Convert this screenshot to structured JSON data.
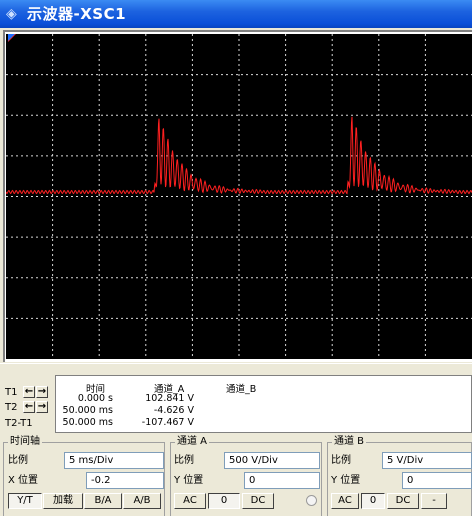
{
  "window": {
    "title": "示波器-XSC1",
    "icon": "oscilloscope-icon"
  },
  "screen": {
    "background": "#000000",
    "grid_color": "#d8d8d8",
    "trace_color": "#ff2020",
    "divisions": {
      "x": 10,
      "y": 8
    },
    "trace_description": "Repeating damped ringing pulses on a flat baseline"
  },
  "cursors": {
    "t1_label": "T1",
    "t2_label": "T2",
    "diff_label": "T2-T1",
    "t1_color": "#ff2020",
    "t2_color": "#1e6fff"
  },
  "readout": {
    "col_time": "时间",
    "col_a": "通道_A",
    "col_b": "通道_B",
    "rows": [
      {
        "time": "0.000 s",
        "a": "102.841 V",
        "b": ""
      },
      {
        "time": "50.000 ms",
        "a": "-4.626 V",
        "b": ""
      },
      {
        "time": "50.000 ms",
        "a": "-107.467 V",
        "b": ""
      }
    ]
  },
  "timebase": {
    "title": "时间轴",
    "scale_label": "比例",
    "scale_value": "5 ms/Div",
    "xpos_label": "X 位置",
    "xpos_value": "-0.2",
    "buttons": [
      "Y/T",
      "加载",
      "B/A",
      "A/B"
    ]
  },
  "channel_a": {
    "title": "通道 A",
    "scale_label": "比例",
    "scale_value": "500  V/Div",
    "ypos_label": "Y 位置",
    "ypos_value": "0",
    "buttons": [
      "AC",
      "0",
      "DC"
    ]
  },
  "channel_b": {
    "title": "通道 B",
    "scale_label": "比例",
    "scale_value": "5  V/Div",
    "ypos_label": "Y 位置",
    "ypos_value": "0",
    "buttons": [
      "AC",
      "0",
      "DC",
      "-"
    ]
  }
}
